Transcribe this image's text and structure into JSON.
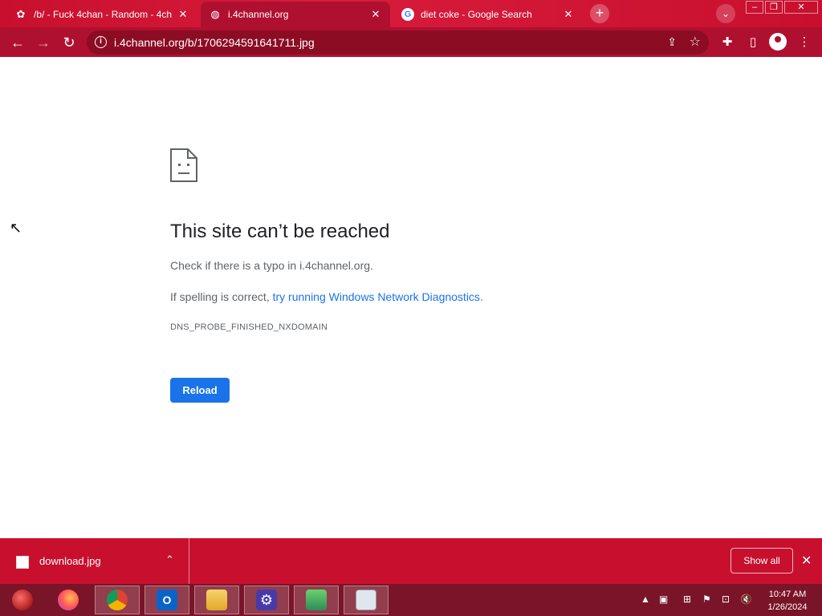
{
  "tabs": [
    {
      "title": "/b/ - Fuck 4chan - Random - 4ch",
      "favicon": "4chan-clover-icon"
    },
    {
      "title": "i.4channel.org",
      "favicon": "globe-icon"
    },
    {
      "title": "diet coke - Google Search",
      "favicon": "google-g-icon"
    }
  ],
  "tab_close": "✕",
  "new_tab": "+",
  "tab_search": "⌄",
  "window": {
    "minimize": "–",
    "maximize": "❐",
    "close": "✕"
  },
  "toolbar": {
    "back": "←",
    "forward": "→",
    "reload": "↻"
  },
  "address": {
    "url": "i.4channel.org/b/1706294591641711.jpg",
    "info": "i"
  },
  "error": {
    "heading": "This site can’t be reached",
    "line1": "Check if there is a typo in i.4channel.org.",
    "line2_prefix": "If spelling is correct, ",
    "line2_link": "try running Windows Network Diagnostics",
    "line2_suffix": ".",
    "code": "DNS_PROBE_FINISHED_NXDOMAIN",
    "reload_label": "Reload"
  },
  "download": {
    "filename": "download.jpg",
    "show_all": "Show all",
    "chevron": "⌃",
    "close": "✕"
  },
  "taskbar": {
    "apps": [
      "start-orb",
      "firefox",
      "chrome",
      "outlook",
      "file-explorer",
      "settings",
      "app-installer",
      "performance-monitor"
    ]
  },
  "clock": {
    "time": "10:47 AM",
    "date": "1/26/2024"
  },
  "colors": {
    "theme": "#c8102e",
    "toolbar": "#b01030",
    "link": "#1a73e8",
    "reload_button": "#1a73e8",
    "taskbar": "#7a1428"
  }
}
